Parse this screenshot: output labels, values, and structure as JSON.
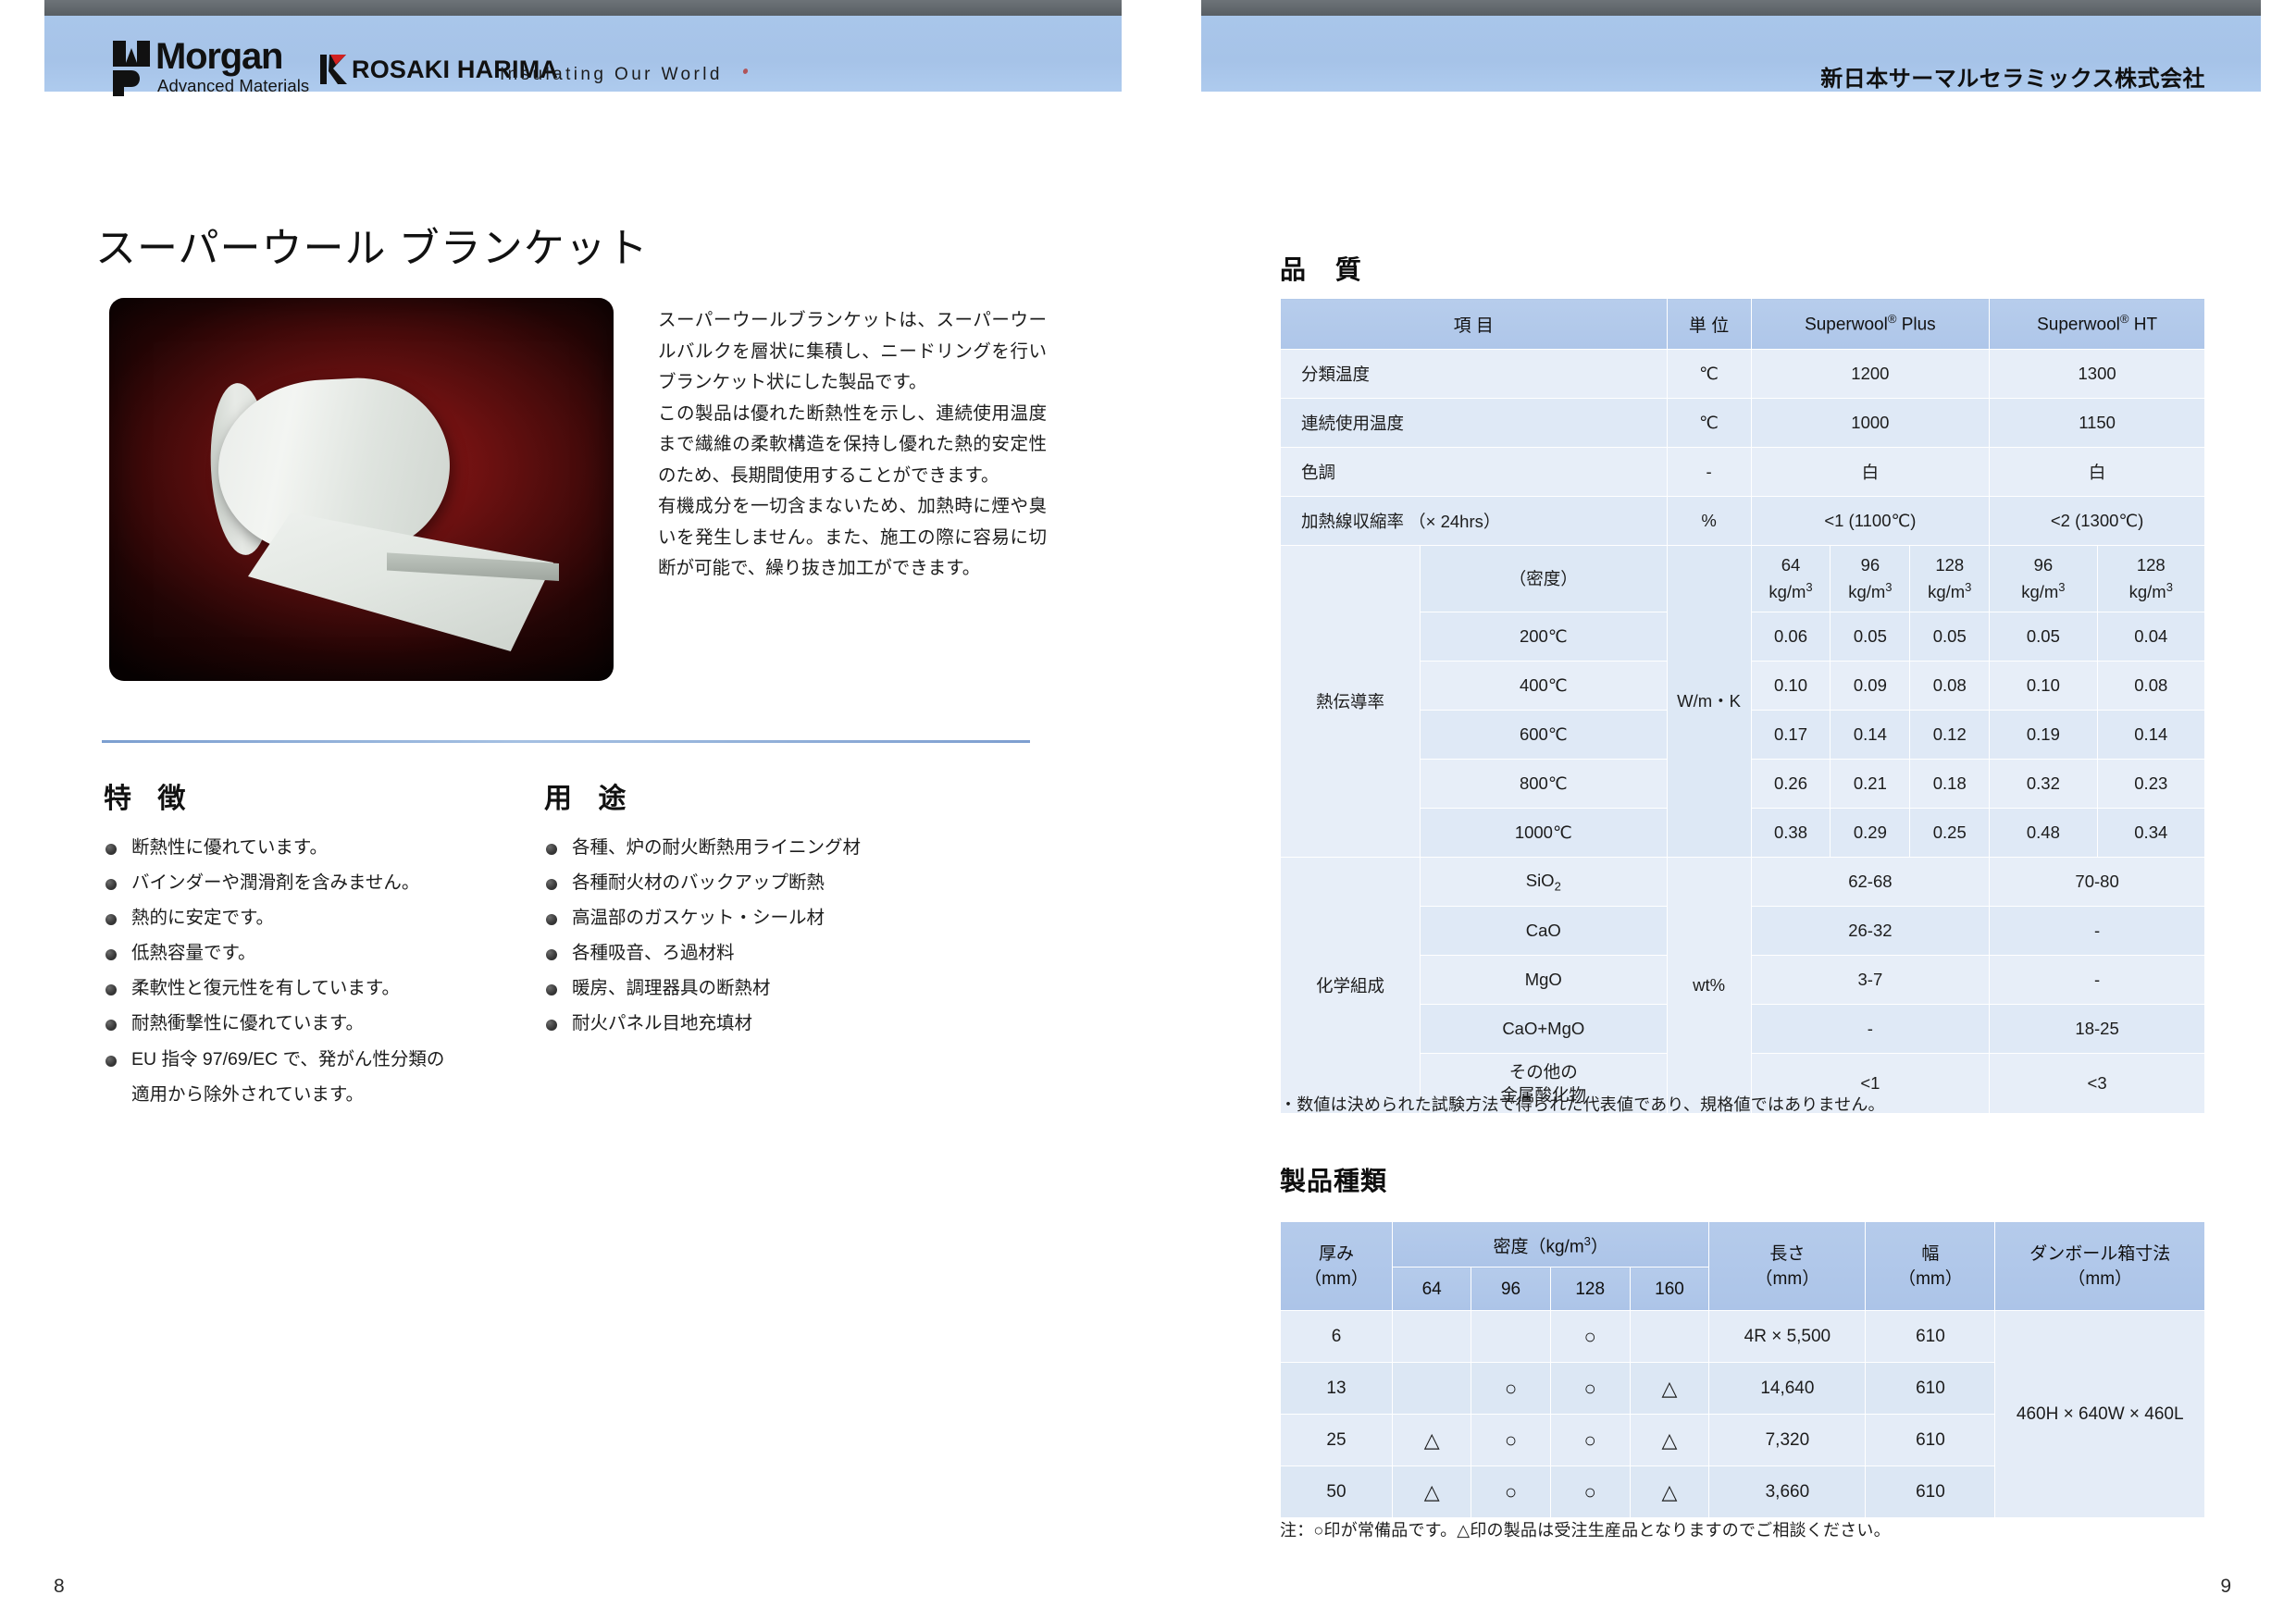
{
  "header": {
    "morgan_word": "Morgan",
    "morgan_sub": "Advanced Materials",
    "krosaki_word": "ROSAKI HARIMA",
    "tagline": "Insulating Our World",
    "company_jp": "新日本サーマルセラミックス株式会社"
  },
  "left": {
    "product_title": "スーパーウール ブランケット",
    "description": [
      "スーパーウールブランケットは、スーパーウールバルクを層状に集積し、ニードリングを行いブランケット状にした製品です。",
      "この製品は優れた断熱性を示し、連続使用温度まで繊維の柔軟構造を保持し優れた熱的安定性のため、長期間使用することができます。",
      "有機成分を一切含まないため、加熱時に煙や臭いを発生しません。また、施工の際に容易に切断が可能で、繰り抜き加工ができます。"
    ],
    "features_heading": "特 徴",
    "features": [
      "断熱性に優れています。",
      "バインダーや潤滑剤を含みません。",
      "熱的に安定です。",
      "低熱容量です。",
      "柔軟性と復元性を有しています。",
      "耐熱衝撃性に優れています。",
      "EU 指令 97/69/EC で、発がん性分類の",
      "適用から除外されています。"
    ],
    "uses_heading": "用 途",
    "uses": [
      "各種、炉の耐火断熱用ライニング材",
      "各種耐火材のバックアップ断熱",
      "高温部のガスケット・シール材",
      "各種吸音、ろ過材料",
      "暖房、調理器具の断熱材",
      "耐火パネル目地充填材"
    ],
    "page_number": "8"
  },
  "right": {
    "quality_heading": "品 質",
    "quality_table": {
      "headers": [
        "項 目",
        "単 位",
        "Superwool® Plus",
        "Superwool® HT"
      ],
      "simple_rows": [
        {
          "item": "分類温度",
          "unit": "℃",
          "plus": "1200",
          "ht": "1300"
        },
        {
          "item": "連続使用温度",
          "unit": "℃",
          "plus": "1000",
          "ht": "1150"
        },
        {
          "item": "色調",
          "unit": "-",
          "plus": "白",
          "ht": "白"
        },
        {
          "item": "加熱線収縮率 （× 24hrs）",
          "unit": "%",
          "plus": "<1 (1100℃)",
          "ht": "<2 (1300℃)"
        }
      ],
      "conductivity": {
        "row_label": "熱伝導率",
        "unit": "W/m・K",
        "density_label": "（密度）",
        "density_headers": [
          "64 kg/m3",
          "96 kg/m3",
          "128 kg/m3",
          "96 kg/m3",
          "128 kg/m3"
        ],
        "densities": [
          "64",
          "96",
          "128",
          "96",
          "128"
        ],
        "density_unit": "kg/m",
        "temps": [
          "200℃",
          "400℃",
          "600℃",
          "800℃",
          "1000℃"
        ],
        "values": [
          [
            "0.06",
            "0.05",
            "0.05",
            "0.05",
            "0.04"
          ],
          [
            "0.10",
            "0.09",
            "0.08",
            "0.10",
            "0.08"
          ],
          [
            "0.17",
            "0.14",
            "0.12",
            "0.19",
            "0.14"
          ],
          [
            "0.26",
            "0.21",
            "0.18",
            "0.32",
            "0.23"
          ],
          [
            "0.38",
            "0.29",
            "0.25",
            "0.48",
            "0.34"
          ]
        ]
      },
      "composition": {
        "row_label": "化学組成",
        "unit": "wt%",
        "rows": [
          {
            "name": "SiO2",
            "plus": "62-68",
            "ht": "70-80"
          },
          {
            "name": "CaO",
            "plus": "26-32",
            "ht": "-"
          },
          {
            "name": "MgO",
            "plus": "3-7",
            "ht": "-"
          },
          {
            "name": "CaO+MgO",
            "plus": "-",
            "ht": "18-25"
          },
          {
            "name": "その他の金属酸化物",
            "plus": "<1",
            "ht": "<3"
          }
        ]
      },
      "note": "・数値は決められた試験方法で得られた代表値であり、規格値ではありません。"
    },
    "types_heading": "製品種類",
    "types_table": {
      "headers": {
        "thickness": "厚み（mm）",
        "density_group": "密度（kg/m3）",
        "density_cols": [
          "64",
          "96",
          "128",
          "160"
        ],
        "length": "長さ（mm）",
        "width": "幅（mm）",
        "carton": "ダンボール箱寸法（mm）"
      },
      "rows": [
        {
          "thickness": "6",
          "d64": "",
          "d96": "",
          "d128": "○",
          "d160": "",
          "length": "4R × 5,500",
          "width": "610"
        },
        {
          "thickness": "13",
          "d64": "",
          "d96": "○",
          "d128": "○",
          "d160": "△",
          "length": "14,640",
          "width": "610"
        },
        {
          "thickness": "25",
          "d64": "△",
          "d96": "○",
          "d128": "○",
          "d160": "△",
          "length": "7,320",
          "width": "610"
        },
        {
          "thickness": "50",
          "d64": "△",
          "d96": "○",
          "d128": "○",
          "d160": "△",
          "length": "3,660",
          "width": "610"
        }
      ],
      "carton_value": "460H × 640W × 460L",
      "note": "注：○印が常備品です。△印の製品は受注生産品となりますのでご相談ください。"
    },
    "page_number": "9"
  }
}
